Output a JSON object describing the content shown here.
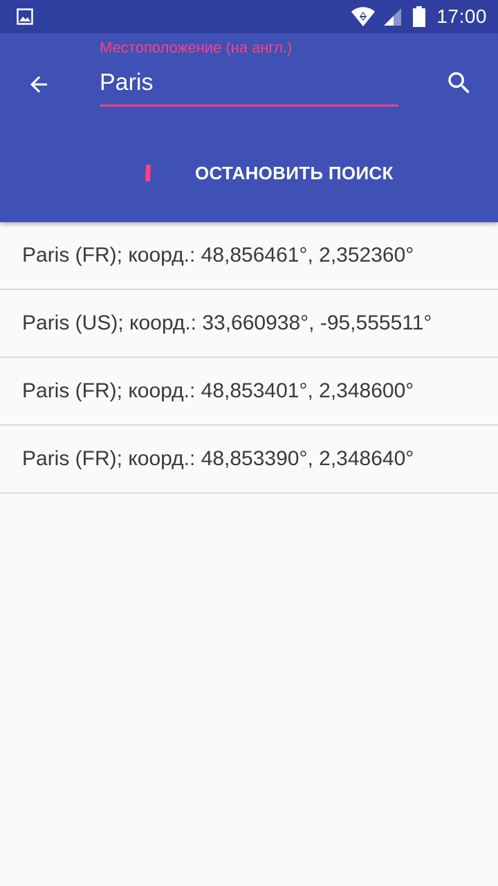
{
  "status_bar": {
    "time": "17:00",
    "icons": [
      "gallery-icon",
      "wifi-icon",
      "signal-icon",
      "battery-icon"
    ]
  },
  "app_bar": {
    "background_color": "#3f51b5",
    "status_bar_color": "#303f9f",
    "accent_color": "#ff4081",
    "back_icon": "arrow-back-icon",
    "search_icon": "search-icon",
    "search_field": {
      "label": "Местоположение (на англ.)",
      "value": "Paris"
    },
    "stop_button_label": "ОСТАНОВИТЬ ПОИСК"
  },
  "results": [
    {
      "label": "Paris (FR); коорд.: 48,856461°, 2,352360°"
    },
    {
      "label": "Paris (US); коорд.: 33,660938°, -95,555511°"
    },
    {
      "label": "Paris (FR); коорд.: 48,853401°, 2,348600°"
    },
    {
      "label": "Paris (FR); коорд.: 48,853390°, 2,348640°"
    }
  ]
}
